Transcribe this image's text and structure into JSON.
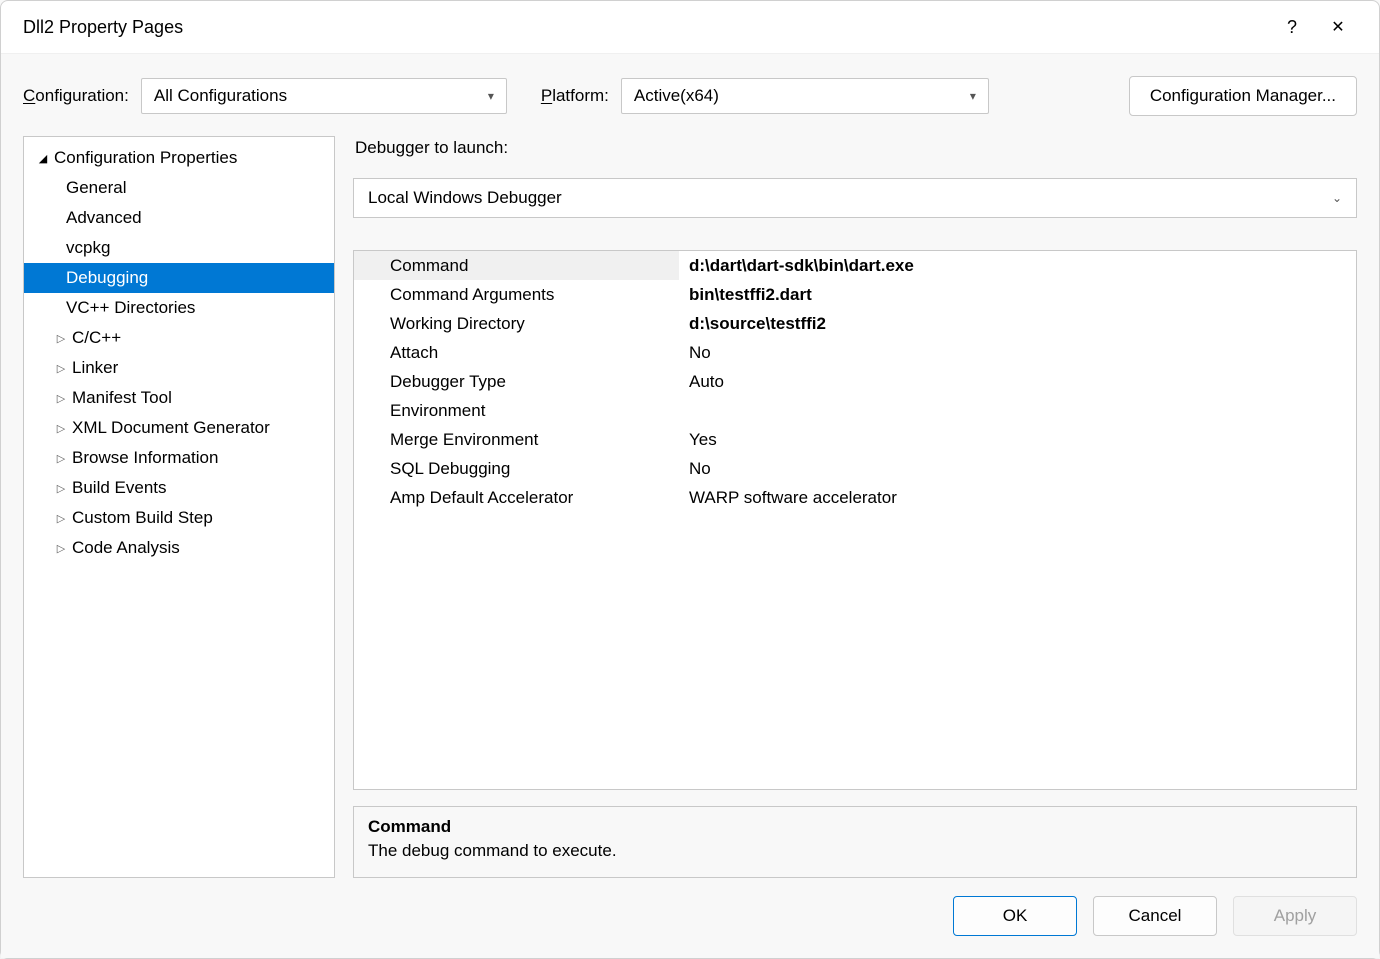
{
  "title": "Dll2 Property Pages",
  "top": {
    "config_label": "Configuration:",
    "config_value": "All Configurations",
    "platform_label": "Platform:",
    "platform_value": "Active(x64)",
    "manager_label": "Configuration Manager..."
  },
  "tree": {
    "root": "Configuration Properties",
    "items": [
      {
        "label": "General",
        "exp": false,
        "arrow": ""
      },
      {
        "label": "Advanced",
        "exp": false,
        "arrow": ""
      },
      {
        "label": "vcpkg",
        "exp": false,
        "arrow": ""
      },
      {
        "label": "Debugging",
        "exp": false,
        "arrow": "",
        "selected": true
      },
      {
        "label": "VC++ Directories",
        "exp": false,
        "arrow": ""
      },
      {
        "label": "C/C++",
        "exp": true,
        "arrow": "▷"
      },
      {
        "label": "Linker",
        "exp": true,
        "arrow": "▷"
      },
      {
        "label": "Manifest Tool",
        "exp": true,
        "arrow": "▷"
      },
      {
        "label": "XML Document Generator",
        "exp": true,
        "arrow": "▷"
      },
      {
        "label": "Browse Information",
        "exp": true,
        "arrow": "▷"
      },
      {
        "label": "Build Events",
        "exp": true,
        "arrow": "▷"
      },
      {
        "label": "Custom Build Step",
        "exp": true,
        "arrow": "▷"
      },
      {
        "label": "Code Analysis",
        "exp": true,
        "arrow": "▷"
      }
    ]
  },
  "debugger": {
    "section_label": "Debugger to launch:",
    "value": "Local Windows Debugger"
  },
  "grid": {
    "rows": [
      {
        "key": "Command",
        "val": "d:\\dart\\dart-sdk\\bin\\dart.exe",
        "bold": true,
        "sel": true
      },
      {
        "key": "Command Arguments",
        "val": "bin\\testffi2.dart",
        "bold": true
      },
      {
        "key": "Working Directory",
        "val": "d:\\source\\testffi2",
        "bold": true
      },
      {
        "key": "Attach",
        "val": "No"
      },
      {
        "key": "Debugger Type",
        "val": "Auto"
      },
      {
        "key": "Environment",
        "val": ""
      },
      {
        "key": "Merge Environment",
        "val": "Yes"
      },
      {
        "key": "SQL Debugging",
        "val": "No"
      },
      {
        "key": "Amp Default Accelerator",
        "val": "WARP software accelerator"
      }
    ]
  },
  "desc": {
    "heading": "Command",
    "text": "The debug command to execute."
  },
  "footer": {
    "ok": "OK",
    "cancel": "Cancel",
    "apply": "Apply"
  }
}
